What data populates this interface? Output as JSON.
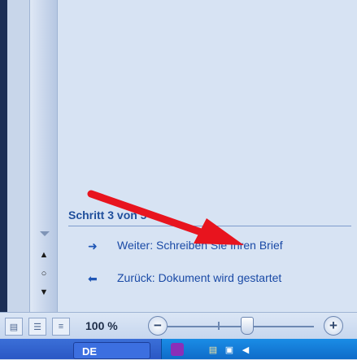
{
  "task_pane": {
    "step_heading": "Schritt 3 von 5",
    "next_link": "Weiter: Schreiben Sie Ihren Brief",
    "prev_link": "Zurück: Dokument wird gestartet"
  },
  "status_bar": {
    "zoom_level": "100 %",
    "zoom_out": "−",
    "zoom_in": "+"
  },
  "taskbar": {
    "language": "DE"
  },
  "colors": {
    "accent": "#1f4f9c",
    "annotation": "#e8141e"
  },
  "icons": [
    "next-arrow-icon",
    "previous-arrow-icon",
    "zoom-out-icon",
    "zoom-in-icon",
    "print-layout-icon",
    "outline-view-icon",
    "draft-view-icon"
  ]
}
